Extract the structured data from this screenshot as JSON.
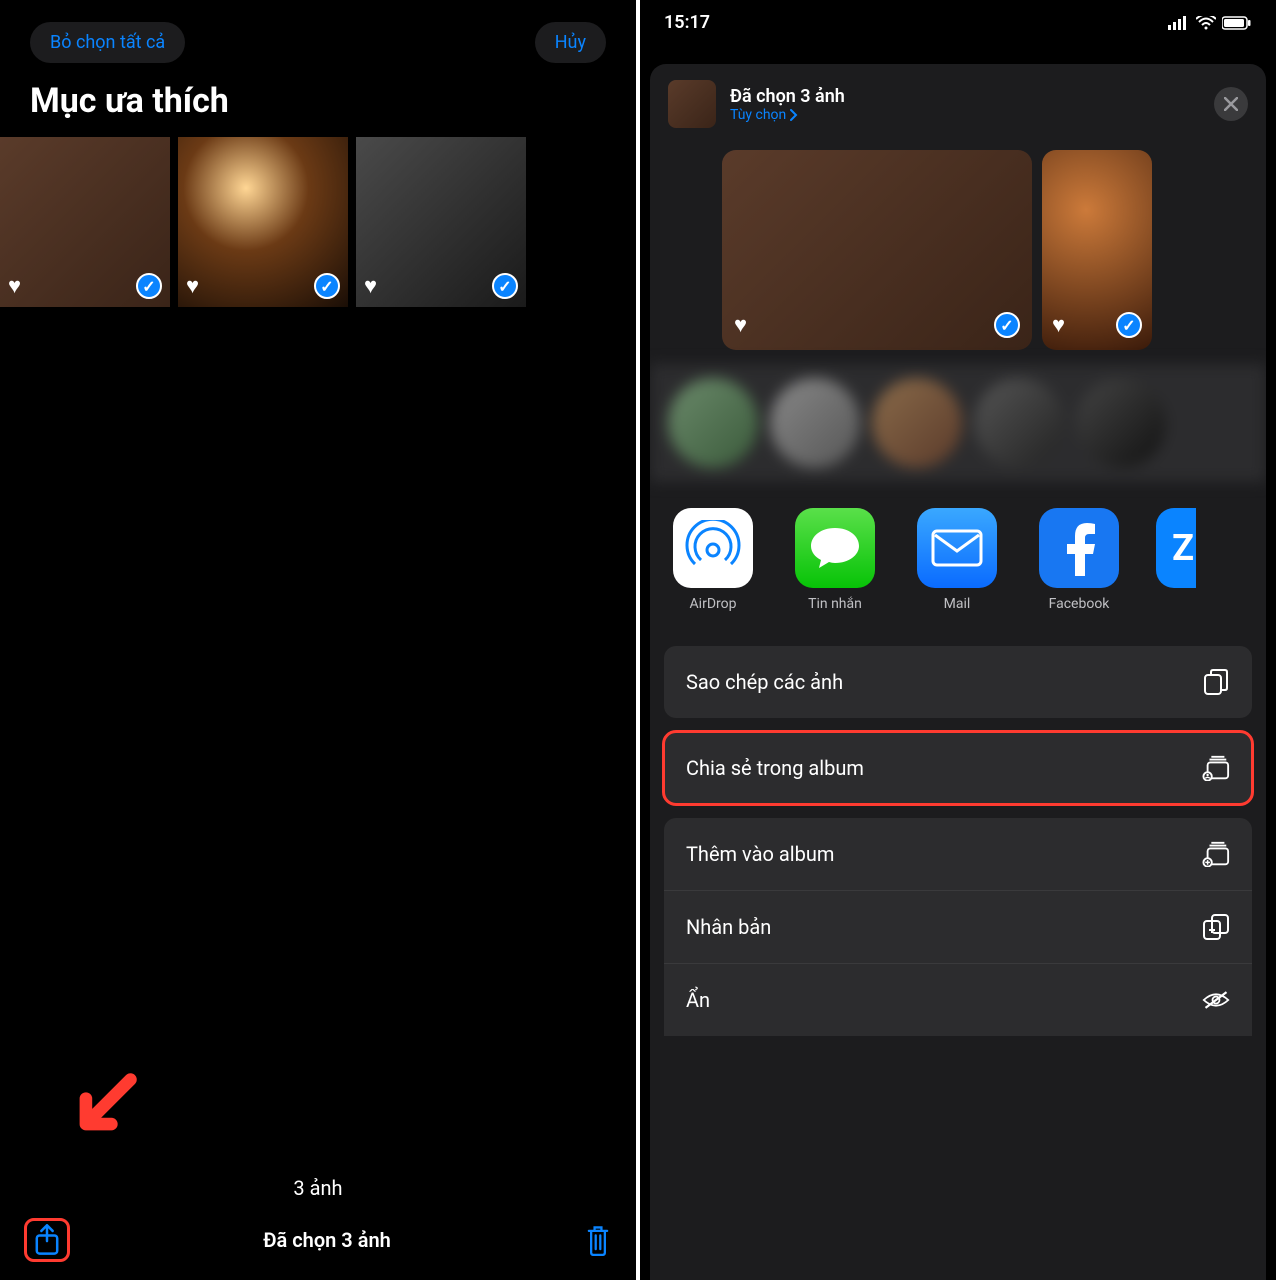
{
  "left": {
    "deselect_all": "Bỏ chọn tất cả",
    "cancel": "Hủy",
    "page_title": "Mục ưa thích",
    "count_text": "3 ảnh",
    "selected_text": "Đã chọn 3 ảnh"
  },
  "right": {
    "time": "15:17",
    "sheet_title": "Đã chọn 3 ảnh",
    "sheet_options": "Tùy chọn",
    "apps": [
      {
        "label": "AirDrop"
      },
      {
        "label": "Tin nhắn"
      },
      {
        "label": "Mail"
      },
      {
        "label": "Facebook"
      },
      {
        "label": ""
      }
    ],
    "actions": {
      "copy": "Sao chép các ảnh",
      "share_album": "Chia sẻ trong album",
      "add_album": "Thêm vào album",
      "duplicate": "Nhân bản",
      "hide": "Ẩn"
    }
  }
}
